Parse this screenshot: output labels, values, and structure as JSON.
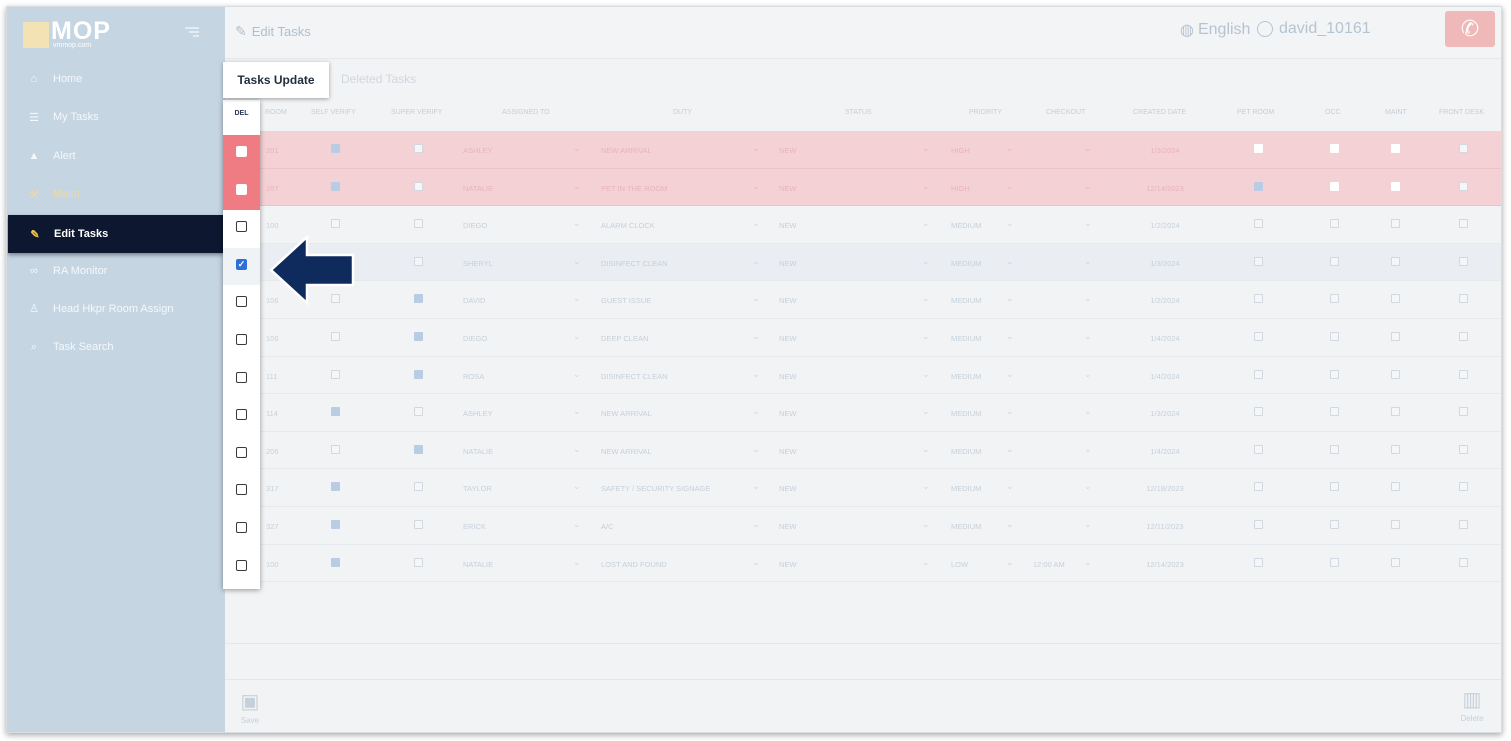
{
  "app": {
    "logo_text": "MOP",
    "logo_sub": "vmmop.com"
  },
  "sidebar": {
    "items": [
      {
        "label": "Home",
        "icon": "home-icon"
      },
      {
        "label": "My Tasks",
        "icon": "list-icon"
      },
      {
        "label": "Alert",
        "icon": "alert-icon"
      },
      {
        "label": "Maint",
        "icon": "wrench-icon"
      },
      {
        "label": "Edit Tasks",
        "icon": "edit-icon",
        "active": true
      },
      {
        "label": "RA Monitor",
        "icon": "binoculars-icon"
      },
      {
        "label": "Head Hkpr Room Assign",
        "icon": "person-icon"
      },
      {
        "label": "Task Search",
        "icon": "search-icon"
      }
    ]
  },
  "header": {
    "title": "Edit Tasks",
    "language": "English",
    "user": "david_10161"
  },
  "tabs": {
    "update": "Tasks Update",
    "deleted": "Deleted Tasks"
  },
  "table": {
    "headers": {
      "del": "DEL",
      "room": "ROOM",
      "self_verify": "SELF VERIFY",
      "super_verify": "SUPER VERIFY",
      "assigned_to": "ASSIGNED TO",
      "duty": "DUTY",
      "status": "STATUS",
      "priority": "PRIORITY",
      "checkout": "CHECKOUT",
      "created_date": "CREATED DATE",
      "pet_room": "PET ROOM",
      "occ": "OCC",
      "maint": "MAINT",
      "front_desk": "FRONT DESK"
    },
    "rows": [
      {
        "room": "201",
        "assigned": "ASHLEY",
        "duty": "NEW ARRIVAL",
        "status": "NEW",
        "priority": "HIGH",
        "checkout": "",
        "date": "1/3/2024"
      },
      {
        "room": "207",
        "assigned": "NATALIE",
        "duty": "PET IN THE ROOM",
        "status": "NEW",
        "priority": "HIGH",
        "checkout": "",
        "date": "12/14/2023"
      },
      {
        "room": "100",
        "assigned": "DIEGO",
        "duty": "ALARM CLOCK",
        "status": "NEW",
        "priority": "MEDIUM",
        "checkout": "",
        "date": "1/2/2024"
      },
      {
        "room": "",
        "assigned": "SHERYL",
        "duty": "DISINFECT CLEAN",
        "status": "NEW",
        "priority": "MEDIUM",
        "checkout": "",
        "date": "1/3/2024"
      },
      {
        "room": "106",
        "assigned": "DAVID",
        "duty": "GUEST ISSUE",
        "status": "NEW",
        "priority": "MEDIUM",
        "checkout": "",
        "date": "1/2/2024"
      },
      {
        "room": "106",
        "assigned": "DIEGO",
        "duty": "DEEP CLEAN",
        "status": "NEW",
        "priority": "MEDIUM",
        "checkout": "",
        "date": "1/4/2024"
      },
      {
        "room": "111",
        "assigned": "ROSA",
        "duty": "DISINFECT CLEAN",
        "status": "NEW",
        "priority": "MEDIUM",
        "checkout": "",
        "date": "1/4/2024"
      },
      {
        "room": "114",
        "assigned": "ASHLEY",
        "duty": "NEW ARRIVAL",
        "status": "NEW",
        "priority": "MEDIUM",
        "checkout": "",
        "date": "1/3/2024"
      },
      {
        "room": "206",
        "assigned": "NATALIE",
        "duty": "NEW ARRIVAL",
        "status": "NEW",
        "priority": "MEDIUM",
        "checkout": "",
        "date": "1/4/2024"
      },
      {
        "room": "317",
        "assigned": "TAYLOR",
        "duty": "SAFETY / SECURITY SIGNAGE",
        "status": "NEW",
        "priority": "MEDIUM",
        "checkout": "",
        "date": "12/18/2023"
      },
      {
        "room": "327",
        "assigned": "ERICK",
        "duty": "A/C",
        "status": "NEW",
        "priority": "MEDIUM",
        "checkout": "",
        "date": "12/11/2023"
      },
      {
        "room": "100",
        "assigned": "NATALIE",
        "duty": "LOST AND FOUND",
        "status": "NEW",
        "priority": "LOW",
        "checkout": "12:00 AM",
        "date": "12/14/2023"
      }
    ]
  },
  "footer": {
    "save": "Save",
    "delete": "Delete"
  },
  "colors": {
    "sidebar_bg": "#c5d5e2",
    "active_nav": "#0d1730",
    "pink_row": "#f4d1d4",
    "arrow": "#0f2a5c",
    "checkbox_checked": "#2f6fd8"
  }
}
